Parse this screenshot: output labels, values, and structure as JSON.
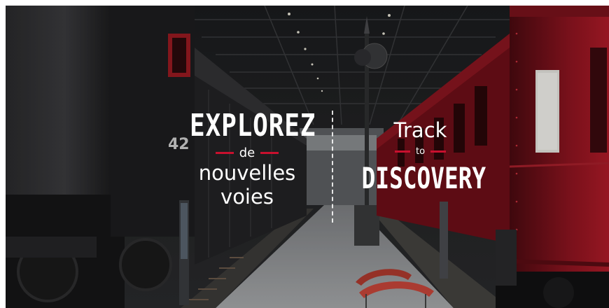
{
  "hero": {
    "french": {
      "line1": "EXPLOREZ",
      "line2": "de",
      "line3": "nouvelles",
      "line4": "voies"
    },
    "english": {
      "line1": "Track",
      "line2": "to",
      "line3": "DISCOVERY"
    },
    "locomotive_number": "42",
    "accent_color": "#c8102e"
  }
}
